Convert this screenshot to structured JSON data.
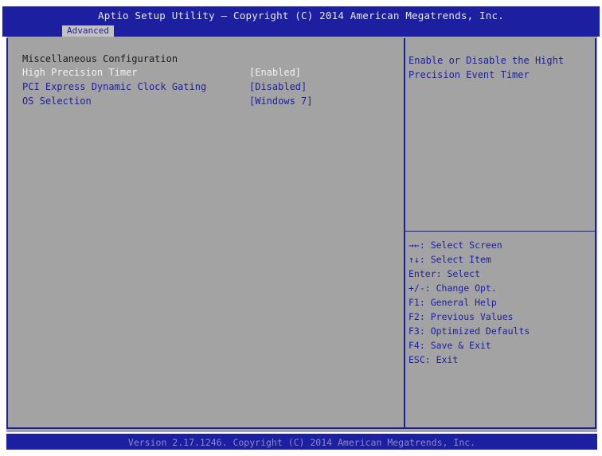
{
  "header": {
    "title": "Aptio Setup Utility – Copyright (C) 2014 American Megatrends, Inc.",
    "active_tab": "Advanced"
  },
  "section_title": "Miscellaneous Configuration",
  "settings": [
    {
      "label": "High Precision Timer",
      "value": "[Enabled]",
      "selected": true
    },
    {
      "label": "PCI Express Dynamic Clock Gating",
      "value": "[Disabled]",
      "selected": false
    },
    {
      "label": "OS Selection",
      "value": "[Windows 7]",
      "selected": false
    }
  ],
  "help_text": "Enable or Disable the Hight Precision Event Timer",
  "key_help": [
    "→←: Select Screen",
    "↑↓: Select Item",
    "Enter: Select",
    "+/-: Change Opt.",
    "F1: General Help",
    "F2: Previous Values",
    "F3: Optimized Defaults",
    "F4: Save & Exit",
    "ESC: Exit"
  ],
  "footer": "Version 2.17.1246. Copyright (C) 2014 American Megatrends, Inc.",
  "colors": {
    "bios_blue": "#1c1fa0",
    "panel_gray": "#a3a3a3",
    "selected_text": "#f2f2f2"
  }
}
